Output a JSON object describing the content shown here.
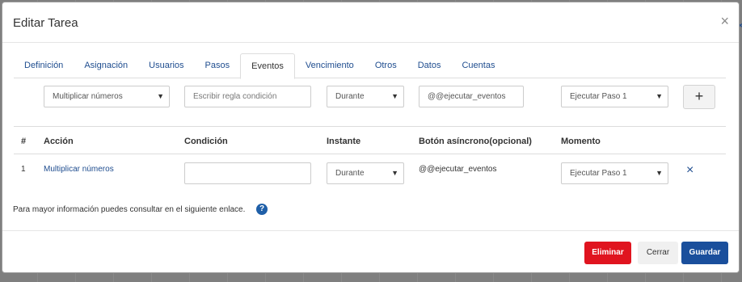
{
  "modal": {
    "title": "Editar Tarea",
    "close_icon": "×"
  },
  "tabs": [
    {
      "label": "Definición",
      "active": false
    },
    {
      "label": "Asignación",
      "active": false
    },
    {
      "label": "Usuarios",
      "active": false
    },
    {
      "label": "Pasos",
      "active": false
    },
    {
      "label": "Eventos",
      "active": true
    },
    {
      "label": "Vencimiento",
      "active": false
    },
    {
      "label": "Otros",
      "active": false
    },
    {
      "label": "Datos",
      "active": false
    },
    {
      "label": "Cuentas",
      "active": false
    }
  ],
  "new_event": {
    "action_select": "Multiplicar números",
    "condition_placeholder": "Escribir regla condición",
    "instant_select": "Durante",
    "async_button_value": "@@ejecutar_eventos",
    "moment_select": "Ejecutar Paso 1",
    "add_label": "+"
  },
  "table": {
    "headers": {
      "num": "#",
      "action": "Acción",
      "condition": "Condición",
      "instant": "Instante",
      "async": "Botón asíncrono(opcional)",
      "moment": "Momento"
    },
    "rows": [
      {
        "num": "1",
        "action": "Multiplicar números",
        "condition": "",
        "instant": "Durante",
        "async": "@@ejecutar_eventos",
        "moment": "Ejecutar Paso 1",
        "remove_icon": "×"
      }
    ]
  },
  "info": {
    "text": "Para mayor información puedes consultar en el siguiente enlace.",
    "help_icon": "?"
  },
  "footer": {
    "delete_label": "Eliminar",
    "close_label": "Cerrar",
    "save_label": "Guardar"
  },
  "colors": {
    "primary": "#1a4f9c",
    "danger": "#e0141f",
    "link": "#1f4d8f"
  },
  "select_arrow": "▼"
}
